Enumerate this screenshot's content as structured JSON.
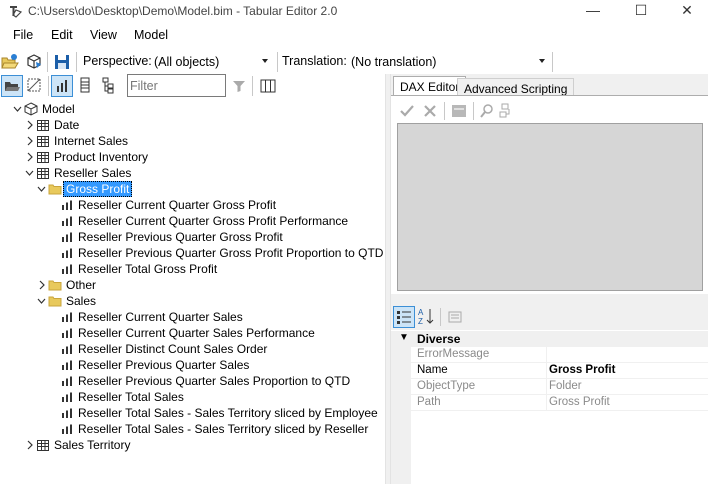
{
  "window": {
    "title": "C:\\Users\\do\\Desktop\\Demo\\Model.bim - Tabular Editor 2.0",
    "minimize": "—",
    "maximize": "☐",
    "close": "✕"
  },
  "menu": [
    "File",
    "Edit",
    "View",
    "Model"
  ],
  "toolbar": {
    "perspective_label": "Perspective:",
    "perspective_value": "(All objects)",
    "translation_label": "Translation:",
    "translation_value": "(No translation)"
  },
  "filter": {
    "placeholder": "Filter",
    "value": ""
  },
  "tree": [
    {
      "label": "Model",
      "icon": "model-icon",
      "expander": "expanded",
      "level": 0
    },
    {
      "label": "Date",
      "icon": "table-icon",
      "expander": "collapsed",
      "level": 1
    },
    {
      "label": "Internet Sales",
      "icon": "table-icon",
      "expander": "collapsed",
      "level": 1
    },
    {
      "label": "Product Inventory",
      "icon": "table-icon",
      "expander": "collapsed",
      "level": 1
    },
    {
      "label": "Reseller Sales",
      "icon": "table-icon",
      "expander": "expanded",
      "level": 1
    },
    {
      "label": "Gross Profit",
      "icon": "folder-icon",
      "expander": "expanded",
      "level": 2,
      "selected": true
    },
    {
      "label": "Reseller Current Quarter Gross Profit",
      "icon": "measure-icon",
      "level": 3
    },
    {
      "label": "Reseller Current Quarter Gross Profit Performance",
      "icon": "measure-icon",
      "level": 3
    },
    {
      "label": "Reseller Previous Quarter Gross Profit",
      "icon": "measure-icon",
      "level": 3
    },
    {
      "label": "Reseller Previous Quarter Gross Profit Proportion to QTD",
      "icon": "measure-icon",
      "level": 3
    },
    {
      "label": "Reseller Total Gross Profit",
      "icon": "measure-icon",
      "level": 3
    },
    {
      "label": "Other",
      "icon": "folder-icon",
      "expander": "collapsed",
      "level": 2
    },
    {
      "label": "Sales",
      "icon": "folder-icon",
      "expander": "expanded",
      "level": 2
    },
    {
      "label": "Reseller Current Quarter Sales",
      "icon": "measure-icon",
      "level": 3
    },
    {
      "label": "Reseller Current Quarter Sales Performance",
      "icon": "measure-icon",
      "level": 3
    },
    {
      "label": "Reseller Distinct Count Sales Order",
      "icon": "measure-icon",
      "level": 3
    },
    {
      "label": "Reseller Previous Quarter Sales",
      "icon": "measure-icon",
      "level": 3
    },
    {
      "label": "Reseller Previous Quarter Sales Proportion to QTD",
      "icon": "measure-icon",
      "level": 3
    },
    {
      "label": "Reseller Total Sales",
      "icon": "measure-icon",
      "level": 3
    },
    {
      "label": "Reseller Total Sales - Sales Territory sliced by Employee",
      "icon": "measure-icon",
      "level": 3
    },
    {
      "label": "Reseller Total Sales - Sales Territory sliced by Reseller",
      "icon": "measure-icon",
      "level": 3
    },
    {
      "label": "Sales Territory",
      "icon": "table-icon",
      "expander": "collapsed",
      "level": 1
    }
  ],
  "tabs": {
    "dax_editor": "DAX Editor",
    "advanced_scripting": "Advanced Scripting"
  },
  "properties": {
    "category": "Diverse",
    "rows": [
      {
        "key": "ErrorMessage",
        "value": "",
        "enabled": false,
        "bold": false
      },
      {
        "key": "Name",
        "value": "Gross Profit",
        "enabled": true,
        "bold": true
      },
      {
        "key": "ObjectType",
        "value": "Folder",
        "enabled": false,
        "bold": false
      },
      {
        "key": "Path",
        "value": "Gross Profit",
        "enabled": false,
        "bold": false
      }
    ]
  },
  "colors": {
    "selection": "#3399ff",
    "folder": "#e8c95c",
    "accent": "#3c8fd6"
  }
}
